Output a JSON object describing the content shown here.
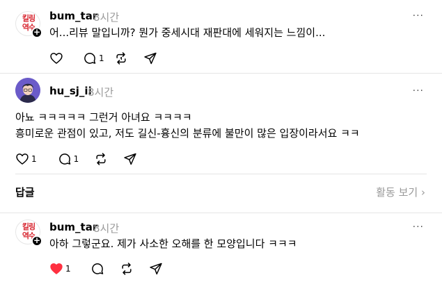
{
  "post1": {
    "avatar_text": "킬링\n역수",
    "username": "bum_tar",
    "time": "8시간",
    "more": "···",
    "text": "어...리뷰 말입니까? 뭔가 중세시대 재판대에 세워지는 느낌이...",
    "reply_count": "1"
  },
  "post2": {
    "username": "hu_sj_ii",
    "time": "8시간",
    "more": "···",
    "line1": "아뇨 ㅋㅋㅋㅋㅋ 그런거 아녀요 ㅋㅋㅋㅋ",
    "line2": "흥미로운 관점이 있고, 저도 길신-흉신의 분류에 불만이 많은 입장이라서요 ㅋㅋ",
    "like_count": "1",
    "reply_count": "1"
  },
  "replies": {
    "title": "답글",
    "activity_link": "활동 보기 ›"
  },
  "post3": {
    "avatar_text": "킬링\n역수",
    "username": "bum_tar",
    "time": "8시간",
    "more": "···",
    "text": "아하 그렇군요. 제가 사소한 오해를 한 모양입니다 ㅋㅋㅋ",
    "like_count": "1"
  },
  "colors": {
    "heart_filled": "#ff3040",
    "muted": "#999999",
    "logo_red": "#d7232d"
  }
}
